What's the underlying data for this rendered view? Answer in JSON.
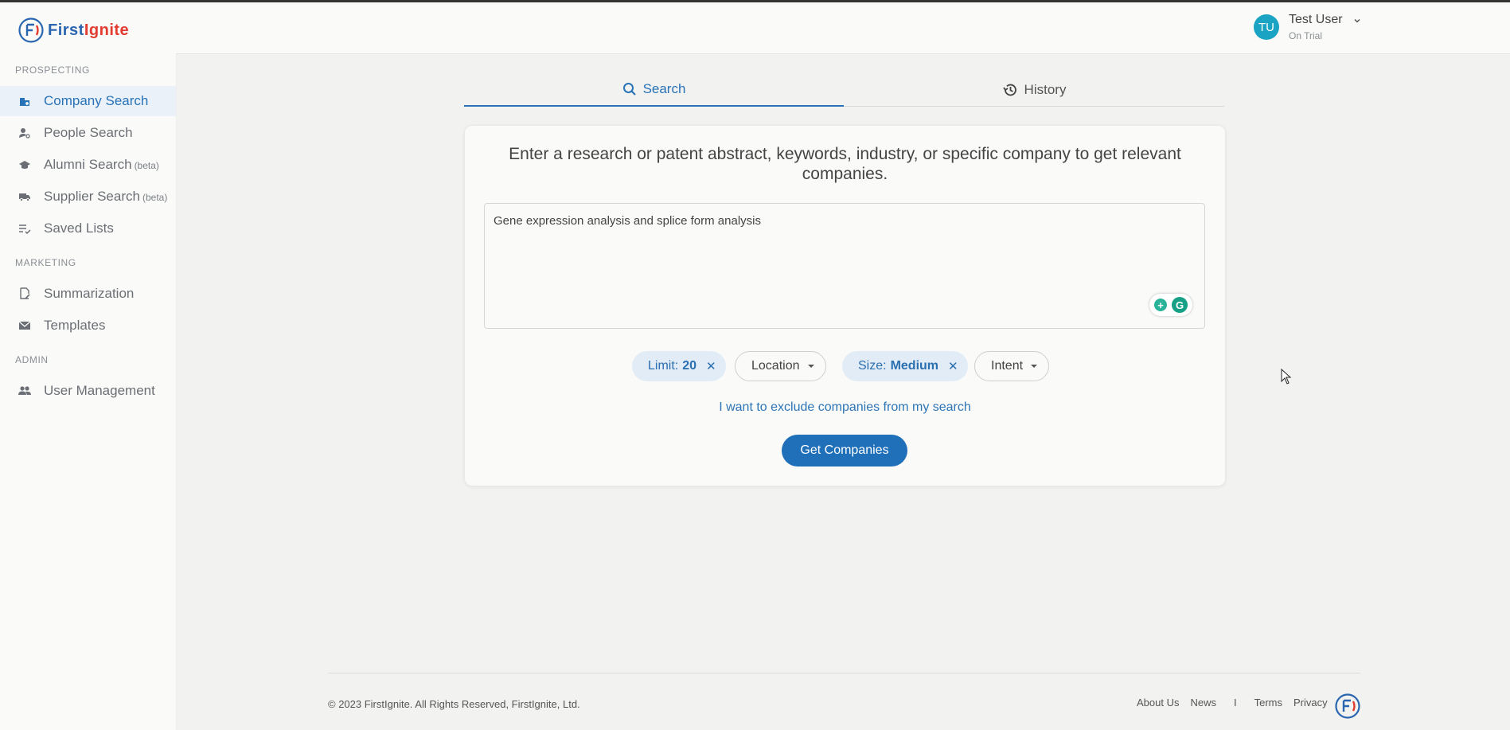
{
  "brand": {
    "first": "First",
    "ignite": "Ignite",
    "blue": "#2a66b0",
    "red": "#e23b2f"
  },
  "sidebar": {
    "sections": [
      {
        "label": "PROSPECTING"
      },
      {
        "label": "MARKETING"
      },
      {
        "label": "ADMIN"
      }
    ],
    "items": [
      {
        "label": "Company Search",
        "icon": "company-search-icon",
        "active": true
      },
      {
        "label": "People Search",
        "icon": "people-search-icon"
      },
      {
        "label": "Alumni Search",
        "badge": "(beta)",
        "icon": "graduation-cap-icon"
      },
      {
        "label": "Supplier Search",
        "badge": "(beta)",
        "icon": "truck-icon"
      },
      {
        "label": "Saved Lists",
        "icon": "checklist-icon"
      },
      {
        "label": "Summarization",
        "icon": "edit-document-icon"
      },
      {
        "label": "Templates",
        "icon": "mail-icon"
      },
      {
        "label": "User Management",
        "icon": "users-icon"
      }
    ]
  },
  "header": {
    "user": {
      "initials": "TU",
      "name": "Test User",
      "status": "On Trial"
    }
  },
  "tabs": [
    {
      "label": "Search",
      "icon": "search-icon",
      "active": true
    },
    {
      "label": "History",
      "icon": "history-icon"
    }
  ],
  "search_card": {
    "prompt": "Enter a research or patent abstract, keywords, industry, or specific company to get relevant companies.",
    "query": "Gene expression analysis and splice form analysis",
    "filters": {
      "limit": {
        "label": "Limit:",
        "value": "20"
      },
      "location": {
        "label": "Location"
      },
      "size": {
        "label": "Size:",
        "value": "Medium"
      },
      "intent": {
        "label": "Intent"
      }
    },
    "exclude_link": "I want to exclude companies from my search",
    "submit_label": "Get Companies"
  },
  "footer": {
    "copyright": "© 2023 FirstIgnite. All Rights Reserved, FirstIgnite, Ltd.",
    "links": [
      "About Us",
      "News",
      "Terms",
      "Privacy"
    ],
    "separator": "I"
  },
  "colors": {
    "accent": "#2872b8",
    "avatar": "#1aa3c2",
    "button": "#1f6fb9",
    "chip_bg": "#e1ecf7"
  }
}
